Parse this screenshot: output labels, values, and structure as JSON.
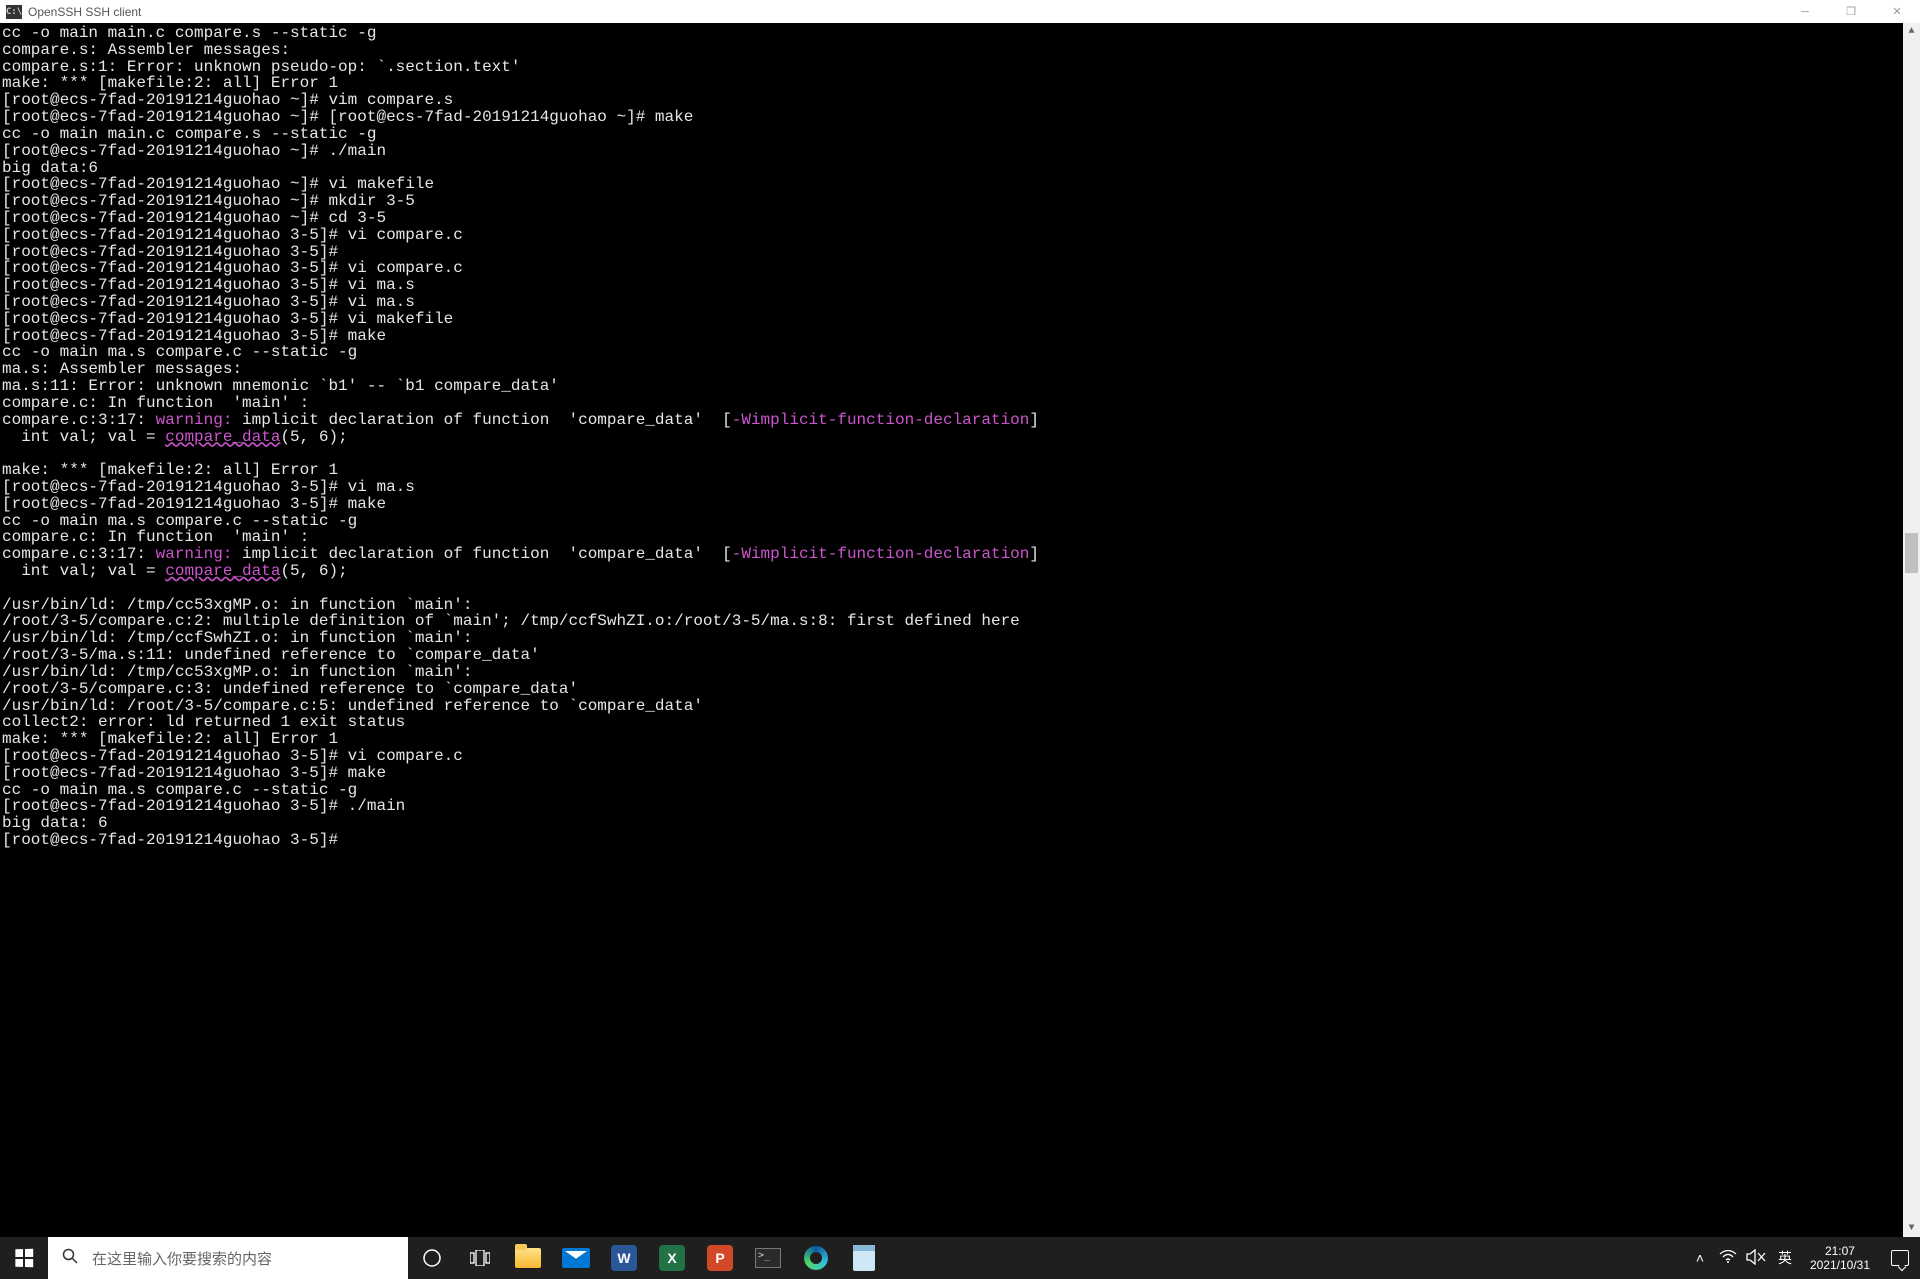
{
  "titlebar": {
    "icon_text": "C:\\",
    "title": "OpenSSH SSH client"
  },
  "term": {
    "l01": "cc -o main main.c compare.s --static -g",
    "l02": "compare.s: Assembler messages:",
    "l03": "compare.s:1: Error: unknown pseudo-op: `.section.text'",
    "l04": "make: *** [makefile:2: all] Error 1",
    "l05": "[root@ecs-7fad-20191214guohao ~]# vim compare.s",
    "l06": "[root@ecs-7fad-20191214guohao ~]# [root@ecs-7fad-20191214guohao ~]# make",
    "l07": "cc -o main main.c compare.s --static -g",
    "l08": "[root@ecs-7fad-20191214guohao ~]# ./main",
    "l09": "big data:6",
    "l10": "[root@ecs-7fad-20191214guohao ~]# vi makefile",
    "l11": "[root@ecs-7fad-20191214guohao ~]# mkdir 3-5",
    "l12": "[root@ecs-7fad-20191214guohao ~]# cd 3-5",
    "l13": "[root@ecs-7fad-20191214guohao 3-5]# vi compare.c",
    "l14": "[root@ecs-7fad-20191214guohao 3-5]#",
    "l15": "[root@ecs-7fad-20191214guohao 3-5]# vi compare.c",
    "l16": "[root@ecs-7fad-20191214guohao 3-5]# vi ma.s",
    "l17": "[root@ecs-7fad-20191214guohao 3-5]# vi ma.s",
    "l18": "[root@ecs-7fad-20191214guohao 3-5]# vi makefile",
    "l19": "[root@ecs-7fad-20191214guohao 3-5]# make",
    "l20": "cc -o main ma.s compare.c --static -g",
    "l21": "ma.s: Assembler messages:",
    "l22": "ma.s:11: Error: unknown mnemonic `b1' -- `b1 compare_data'",
    "l23": "compare.c: In function  'main' :",
    "l24a": "compare.c:3:17: ",
    "l24b": "warning: ",
    "l24c": "implicit declaration of function  'compare_data'  [",
    "l24d": "-Wimplicit-function-declaration",
    "l24e": "]",
    "l25a": "  int val; val = ",
    "l25b": "compare_data",
    "l25c": "(5, 6);",
    "l26": "",
    "l27": "make: *** [makefile:2: all] Error 1",
    "l28": "[root@ecs-7fad-20191214guohao 3-5]# vi ma.s",
    "l29": "[root@ecs-7fad-20191214guohao 3-5]# make",
    "l30": "cc -o main ma.s compare.c --static -g",
    "l31": "compare.c: In function  'main' :",
    "l32a": "compare.c:3:17: ",
    "l32b": "warning: ",
    "l32c": "implicit declaration of function  'compare_data'  [",
    "l32d": "-Wimplicit-function-declaration",
    "l32e": "]",
    "l33a": "  int val; val = ",
    "l33b": "compare_data",
    "l33c": "(5, 6);",
    "l34": "",
    "l35": "/usr/bin/ld: /tmp/cc53xgMP.o: in function `main':",
    "l36": "/root/3-5/compare.c:2: multiple definition of `main'; /tmp/ccfSwhZI.o:/root/3-5/ma.s:8: first defined here",
    "l37": "/usr/bin/ld: /tmp/ccfSwhZI.o: in function `main':",
    "l38": "/root/3-5/ma.s:11: undefined reference to `compare_data'",
    "l39": "/usr/bin/ld: /tmp/cc53xgMP.o: in function `main':",
    "l40": "/root/3-5/compare.c:3: undefined reference to `compare_data'",
    "l41": "/usr/bin/ld: /root/3-5/compare.c:5: undefined reference to `compare_data'",
    "l42": "collect2: error: ld returned 1 exit status",
    "l43": "make: *** [makefile:2: all] Error 1",
    "l44": "[root@ecs-7fad-20191214guohao 3-5]# vi compare.c",
    "l45": "[root@ecs-7fad-20191214guohao 3-5]# make",
    "l46": "cc -o main ma.s compare.c --static -g",
    "l47": "[root@ecs-7fad-20191214guohao 3-5]# ./main",
    "l48": "big data: 6",
    "l49": "[root@ecs-7fad-20191214guohao 3-5]#"
  },
  "taskbar": {
    "search_placeholder": "在这里输入你要搜索的内容",
    "word_label": "W",
    "excel_label": "X",
    "ppt_label": "P",
    "cmd_label": ">_",
    "ime_label": "英",
    "time": "21:07",
    "date": "2021/10/31",
    "chevron": "˄",
    "wifi": "⌔",
    "vol": "🕨×"
  }
}
